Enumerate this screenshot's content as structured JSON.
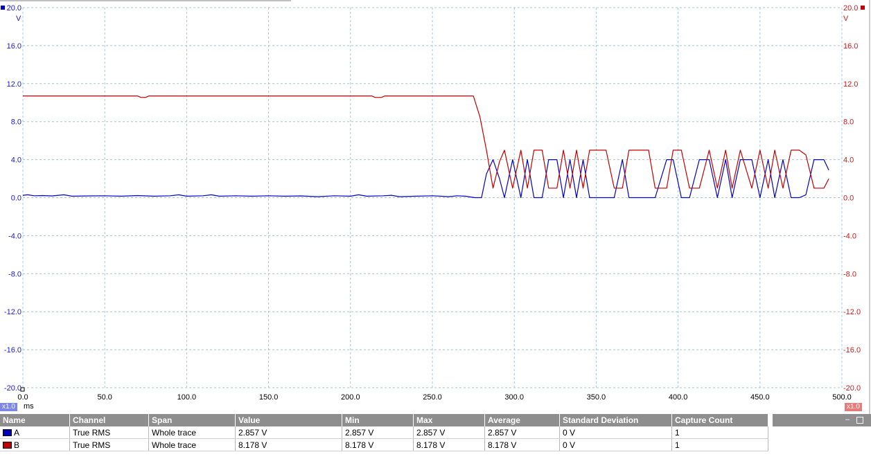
{
  "chart_data": {
    "type": "line",
    "x_unit": "ms",
    "x_ticks": [
      "0.0",
      "50.0",
      "100.0",
      "150.0",
      "200.0",
      "250.0",
      "300.0",
      "350.0",
      "400.0",
      "450.0",
      "500.0"
    ],
    "xlim": [
      0,
      500
    ],
    "ylim": [
      -20,
      20
    ],
    "y_unit": "V",
    "y_ticks": [
      "20.0",
      "16.0",
      "12.0",
      "8.0",
      "4.0",
      "0.0",
      "-4.0",
      "-8.0",
      "-12.0",
      "-16.0",
      "-20.0"
    ],
    "grid": true,
    "series": [
      {
        "name": "A",
        "color": "#0000c0",
        "points": [
          [
            0,
            0.25
          ],
          [
            3,
            0.3
          ],
          [
            7,
            0.2
          ],
          [
            12,
            0.22
          ],
          [
            18,
            0.18
          ],
          [
            25,
            0.3
          ],
          [
            30,
            0.15
          ],
          [
            40,
            0.18
          ],
          [
            50,
            0.2
          ],
          [
            60,
            0.15
          ],
          [
            70,
            0.22
          ],
          [
            80,
            0.15
          ],
          [
            90,
            0.2
          ],
          [
            95,
            0.3
          ],
          [
            100,
            0.15
          ],
          [
            110,
            0.2
          ],
          [
            115,
            0.3
          ],
          [
            120,
            0.15
          ],
          [
            130,
            0.2
          ],
          [
            140,
            0.15
          ],
          [
            150,
            0.2
          ],
          [
            160,
            0.15
          ],
          [
            170,
            0.18
          ],
          [
            180,
            0.1
          ],
          [
            190,
            0.2
          ],
          [
            200,
            0.15
          ],
          [
            205,
            0.3
          ],
          [
            210,
            0.15
          ],
          [
            220,
            0.2
          ],
          [
            225,
            0.25
          ],
          [
            230,
            0.1
          ],
          [
            240,
            0.15
          ],
          [
            250,
            0.2
          ],
          [
            255,
            0.15
          ],
          [
            260,
            0.1
          ],
          [
            265,
            0.2
          ],
          [
            270,
            0.15
          ],
          [
            276,
            0.0
          ],
          [
            280,
            0.0
          ],
          [
            283,
            2.5
          ],
          [
            287,
            4.0
          ],
          [
            291,
            2.0
          ],
          [
            294,
            0.0
          ],
          [
            299,
            4.0
          ],
          [
            304,
            0.0
          ],
          [
            308,
            4.0
          ],
          [
            312,
            0.0
          ],
          [
            317,
            0.0
          ],
          [
            321,
            4.0
          ],
          [
            326,
            4.0
          ],
          [
            330,
            0.0
          ],
          [
            334,
            4.0
          ],
          [
            338,
            0.0
          ],
          [
            342,
            4.0
          ],
          [
            346,
            0.0
          ],
          [
            350,
            0.0
          ],
          [
            356,
            0.0
          ],
          [
            361,
            0.0
          ],
          [
            366,
            4.0
          ],
          [
            370,
            0.0
          ],
          [
            374,
            0.0
          ],
          [
            382,
            0.0
          ],
          [
            386,
            0.0
          ],
          [
            393,
            4.0
          ],
          [
            397,
            4.0
          ],
          [
            402,
            0.0
          ],
          [
            407,
            0.0
          ],
          [
            413,
            4.0
          ],
          [
            419,
            4.0
          ],
          [
            424,
            0.0
          ],
          [
            429,
            4.0
          ],
          [
            433,
            0.0
          ],
          [
            438,
            4.0
          ],
          [
            445,
            4.0
          ],
          [
            450,
            0.0
          ],
          [
            455,
            4.0
          ],
          [
            459,
            0.0
          ],
          [
            464,
            4.0
          ],
          [
            469,
            0.0
          ],
          [
            474,
            0.0
          ],
          [
            478,
            0.3
          ],
          [
            483,
            4.0
          ],
          [
            489,
            4.0
          ],
          [
            492,
            2.9
          ]
        ]
      },
      {
        "name": "B",
        "color": "#c00000",
        "points": [
          [
            0,
            10.7
          ],
          [
            70,
            10.7
          ],
          [
            72,
            10.55
          ],
          [
            75,
            10.55
          ],
          [
            77,
            10.7
          ],
          [
            213,
            10.7
          ],
          [
            215,
            10.55
          ],
          [
            219,
            10.55
          ],
          [
            221,
            10.7
          ],
          [
            275,
            10.7
          ],
          [
            279,
            8.5
          ],
          [
            283,
            5.0
          ],
          [
            287,
            1.0
          ],
          [
            291,
            3.8
          ],
          [
            294,
            5.0
          ],
          [
            299,
            1.0
          ],
          [
            304,
            5.0
          ],
          [
            308,
            1.0
          ],
          [
            312,
            5.0
          ],
          [
            317,
            5.0
          ],
          [
            321,
            1.0
          ],
          [
            326,
            1.0
          ],
          [
            330,
            5.0
          ],
          [
            334,
            1.0
          ],
          [
            338,
            5.0
          ],
          [
            342,
            1.0
          ],
          [
            346,
            5.0
          ],
          [
            356,
            5.0
          ],
          [
            361,
            1.0
          ],
          [
            366,
            1.0
          ],
          [
            370,
            5.0
          ],
          [
            382,
            5.0
          ],
          [
            386,
            1.0
          ],
          [
            393,
            1.0
          ],
          [
            397,
            5.0
          ],
          [
            402,
            5.0
          ],
          [
            407,
            1.0
          ],
          [
            413,
            1.0
          ],
          [
            419,
            5.0
          ],
          [
            424,
            1.0
          ],
          [
            429,
            5.0
          ],
          [
            433,
            1.0
          ],
          [
            438,
            5.0
          ],
          [
            445,
            1.0
          ],
          [
            450,
            5.0
          ],
          [
            455,
            1.0
          ],
          [
            459,
            5.0
          ],
          [
            464,
            1.0
          ],
          [
            469,
            5.0
          ],
          [
            474,
            5.0
          ],
          [
            478,
            4.5
          ],
          [
            483,
            1.0
          ],
          [
            489,
            1.0
          ],
          [
            492,
            2.0
          ]
        ]
      }
    ]
  },
  "badges": {
    "left_scale": "x1.0",
    "right_scale": "x1.0",
    "x_unit": "ms",
    "left_unit": "V",
    "right_unit": "V"
  },
  "measurements": {
    "headers": [
      "Name",
      "Channel",
      "Span",
      "Value",
      "Min",
      "Max",
      "Average",
      "Standard Deviation",
      "Capture Count"
    ],
    "rows": [
      {
        "chip": "#0000c0",
        "cells": [
          "A",
          "True RMS",
          "Whole trace",
          "2.857 V",
          "2.857 V",
          "2.857 V",
          "2.857 V",
          "0 V",
          "1"
        ]
      },
      {
        "chip": "#c00000",
        "cells": [
          "B",
          "True RMS",
          "Whole trace",
          "8.178 V",
          "8.178 V",
          "8.178 V",
          "8.178 V",
          "0 V",
          "1"
        ]
      }
    ]
  }
}
